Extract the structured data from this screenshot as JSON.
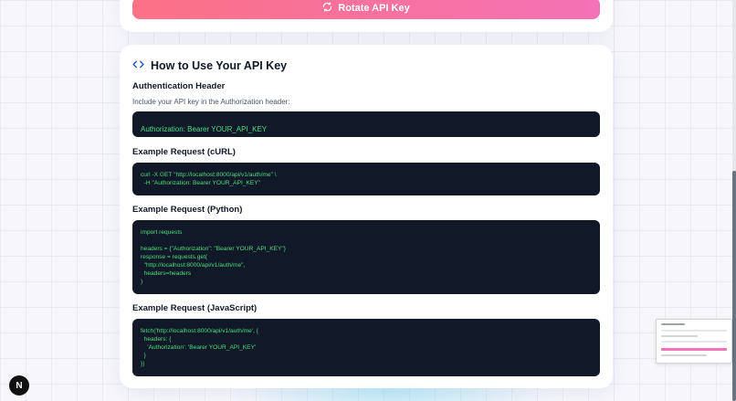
{
  "top_card": {
    "rotate_button_label": "Rotate API Key"
  },
  "usage": {
    "title": "How to Use Your API Key",
    "auth_header": {
      "heading": "Authentication Header",
      "description": "Include your API key in the Authorization header:",
      "code": "Authorization: Bearer YOUR_API_KEY"
    },
    "curl": {
      "heading": "Example Request (cURL)",
      "code": "curl -X GET \"http://localhost:8000/api/v1/auth/me\" \\\n  -H \"Authorization: Bearer YOUR_API_KEY\""
    },
    "python": {
      "heading": "Example Request (Python)",
      "code": "import requests\n\nheaders = {\"Authorization\": \"Bearer YOUR_API_KEY\"}\nresponse = requests.get(\n  \"http://localhost:8000/api/v1/auth/me\",\n  headers=headers\n)"
    },
    "javascript": {
      "heading": "Example Request (JavaScript)",
      "code": "fetch('http://localhost:8000/api/v1/auth/me', {\n  headers: {\n    'Authorization': 'Bearer YOUR_API_KEY'\n  }\n})"
    }
  },
  "dev_badge": {
    "letter": "N"
  },
  "colors": {
    "code_background": "#111827",
    "code_text": "#4ade80",
    "button_gradient_start": "#fb7185",
    "button_gradient_end": "#f472b6",
    "icon_accent": "#1d4ed8"
  },
  "icons": {
    "rotate": "refresh-icon",
    "section": "code-brackets-icon"
  }
}
